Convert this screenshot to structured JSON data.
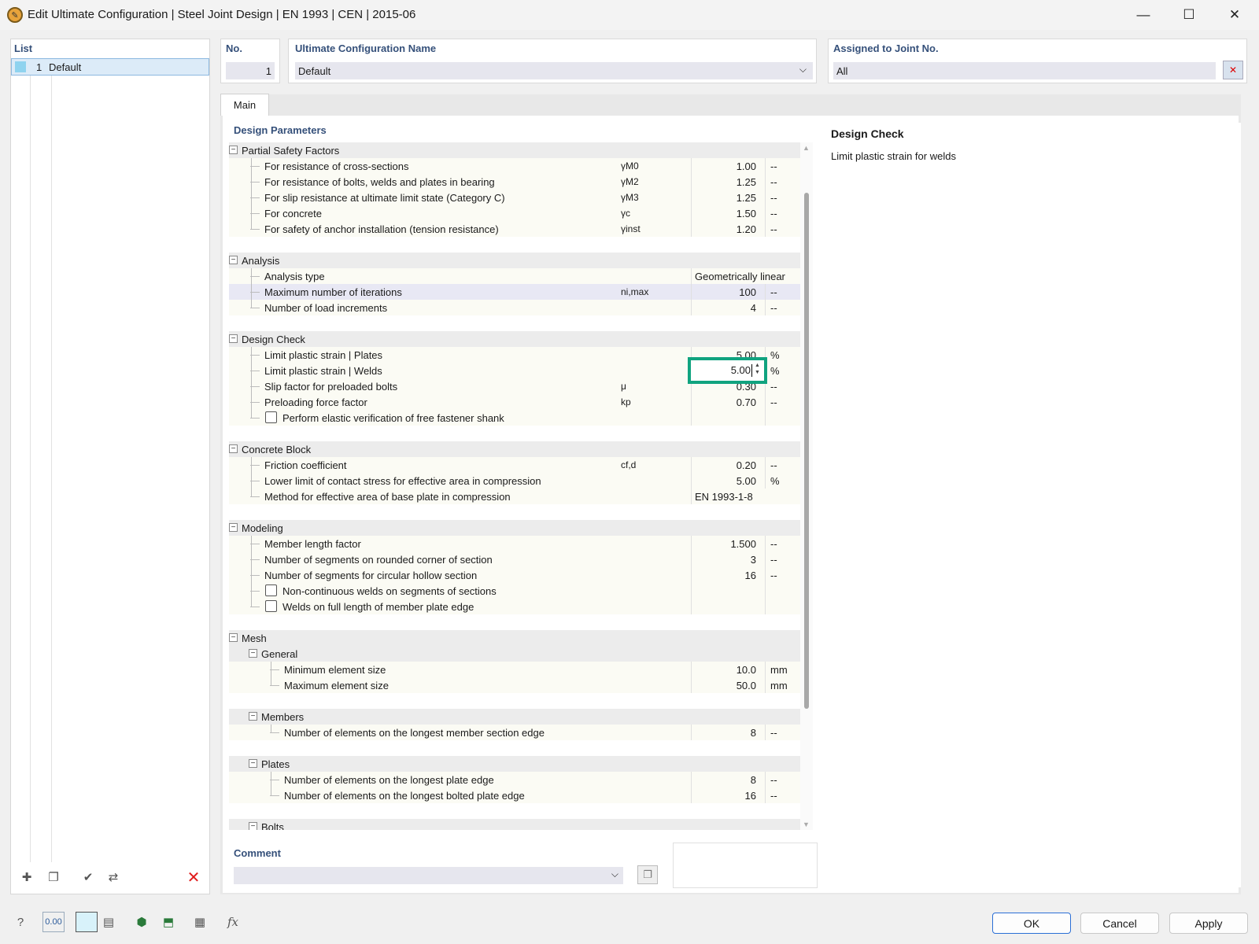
{
  "window": {
    "title": "Edit Ultimate Configuration | Steel Joint Design | EN 1993 | CEN | 2015-06",
    "icon": "app-icon",
    "controls": [
      "minimize-icon",
      "maximize-icon",
      "close-icon"
    ]
  },
  "list": {
    "header": "List",
    "items": [
      {
        "num": "1",
        "label": "Default",
        "color": "#8fd3ef"
      }
    ],
    "tools": [
      "new-item-icon",
      "copy-item-icon",
      "check-all-icon",
      "uncheck-icon",
      "delete-icon"
    ]
  },
  "header": {
    "no_label": "No.",
    "no_value": "1",
    "name_label": "Ultimate Configuration Name",
    "name_value": "Default",
    "assigned_label": "Assigned to Joint No.",
    "assigned_value": "All"
  },
  "tabs": [
    {
      "label": "Main"
    }
  ],
  "design_parameters": {
    "title": "Design Parameters",
    "groups": [
      {
        "label": "Partial Safety Factors",
        "rows": [
          {
            "label": "For resistance of cross-sections",
            "symbol": "γM0",
            "value": "1.00",
            "unit": "--"
          },
          {
            "label": "For resistance of bolts, welds and plates in bearing",
            "symbol": "γM2",
            "value": "1.25",
            "unit": "--"
          },
          {
            "label": "For slip resistance at ultimate limit state (Category C)",
            "symbol": "γM3",
            "value": "1.25",
            "unit": "--"
          },
          {
            "label": "For concrete",
            "symbol": "γc",
            "value": "1.50",
            "unit": "--"
          },
          {
            "label": "For safety of anchor installation (tension resistance)",
            "symbol": "γinst",
            "value": "1.20",
            "unit": "--"
          }
        ]
      },
      {
        "label": "Analysis",
        "rows": [
          {
            "label": "Analysis type",
            "symbol": "",
            "value": "Geometrically linear",
            "unit": ""
          },
          {
            "label": "Maximum number of iterations",
            "symbol": "ni,max",
            "value": "100",
            "unit": "--"
          },
          {
            "label": "Number of load increments",
            "symbol": "",
            "value": "4",
            "unit": "--"
          }
        ]
      },
      {
        "label": "Design Check",
        "rows": [
          {
            "label": "Limit plastic strain | Plates",
            "symbol": "",
            "value": "5.00",
            "unit": "%"
          },
          {
            "label": "Limit plastic strain | Welds",
            "symbol": "",
            "value": "5.00",
            "unit": "%"
          },
          {
            "label": "Slip factor for preloaded bolts",
            "symbol": "μ",
            "value": "0.30",
            "unit": "--"
          },
          {
            "label": "Preloading force factor",
            "symbol": "kp",
            "value": "0.70",
            "unit": "--"
          },
          {
            "label": "Perform elastic verification of free fastener shank",
            "checked": false
          }
        ]
      },
      {
        "label": "Concrete Block",
        "rows": [
          {
            "label": "Friction coefficient",
            "symbol": "cf,d",
            "value": "0.20",
            "unit": "--"
          },
          {
            "label": "Lower limit of contact stress for effective area in compression",
            "symbol": "",
            "value": "5.00",
            "unit": "%"
          },
          {
            "label": "Method for effective area of base plate in compression",
            "symbol": "",
            "value": "EN 1993-1-8",
            "unit": ""
          }
        ]
      },
      {
        "label": "Modeling",
        "rows": [
          {
            "label": "Member length factor",
            "symbol": "",
            "value": "1.500",
            "unit": "--"
          },
          {
            "label": "Number of segments on rounded corner of section",
            "symbol": "",
            "value": "3",
            "unit": "--"
          },
          {
            "label": "Number of segments for circular hollow section",
            "symbol": "",
            "value": "16",
            "unit": "--"
          },
          {
            "label": "Non-continuous welds on segments of sections",
            "checked": false
          },
          {
            "label": "Welds on full length of member plate edge",
            "checked": false
          }
        ]
      },
      {
        "label": "Mesh",
        "subgroups": [
          {
            "label": "General",
            "rows": [
              {
                "label": "Minimum element size",
                "symbol": "",
                "value": "10.0",
                "unit": "mm"
              },
              {
                "label": "Maximum element size",
                "symbol": "",
                "value": "50.0",
                "unit": "mm"
              }
            ]
          },
          {
            "label": "Members",
            "rows": [
              {
                "label": "Number of elements on the longest member section edge",
                "symbol": "",
                "value": "8",
                "unit": "--"
              }
            ]
          },
          {
            "label": "Plates",
            "rows": [
              {
                "label": "Number of elements on the longest plate edge",
                "symbol": "",
                "value": "8",
                "unit": "--"
              },
              {
                "label": "Number of elements on the longest bolted plate edge",
                "symbol": "",
                "value": "16",
                "unit": "--"
              }
            ]
          },
          {
            "label": "Bolts",
            "rows": []
          }
        ]
      }
    ]
  },
  "info_panel": {
    "title": "Design Check",
    "text": "Limit plastic strain for welds"
  },
  "comment": {
    "label": "Comment",
    "value": ""
  },
  "footer": {
    "tools": [
      "help-icon",
      "units-icon",
      "color-icon",
      "info-icon",
      "model-icon",
      "export-icon",
      "table-icon",
      "formula-icon"
    ],
    "units_label": "0.00",
    "ok": "OK",
    "cancel": "Cancel",
    "apply": "Apply"
  },
  "colors": {
    "accent_highlight": "#10a37f",
    "header_blue": "#35507a",
    "selection": "#dcebf8"
  }
}
